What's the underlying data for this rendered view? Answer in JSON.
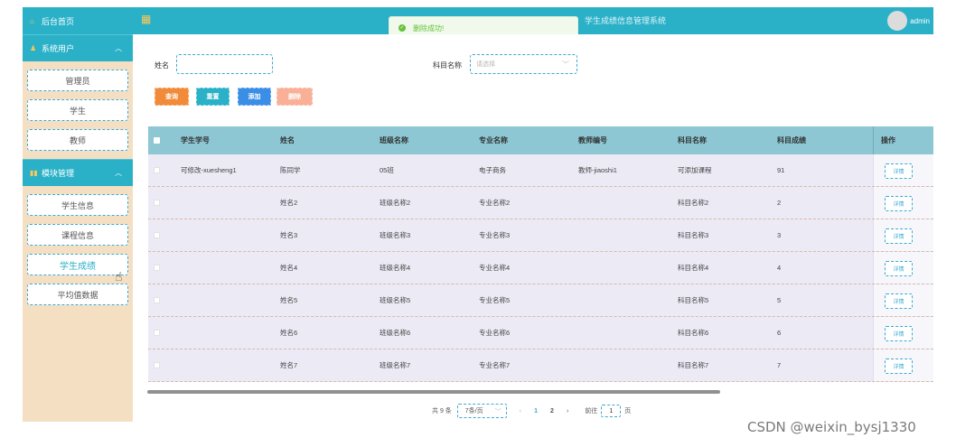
{
  "sidebar": {
    "home_label": "后台首页",
    "groups": [
      {
        "label": "系统用户",
        "items": [
          "管理员",
          "学生",
          "教师"
        ]
      },
      {
        "label": "模块管理",
        "items": [
          "学生信息",
          "课程信息",
          "学生成绩",
          "平均值数据"
        ]
      }
    ],
    "active_item": "学生成绩"
  },
  "topbar": {
    "title": "学生成绩信息管理系统",
    "user": "admin"
  },
  "toast": {
    "message": "删除成功!"
  },
  "search": {
    "name_label": "姓名",
    "name_value": "",
    "subject_label": "科目名称",
    "subject_placeholder": "请选择"
  },
  "buttons": {
    "search": "查询",
    "reset": "重置",
    "add": "添加",
    "delete": "删除"
  },
  "table": {
    "headers": [
      "学生学号",
      "姓名",
      "班级名称",
      "专业名称",
      "教师编号",
      "科目名称",
      "科目成绩",
      "操作"
    ],
    "rows": [
      {
        "id": "可修改-xuesheng1",
        "name": "陈同学",
        "class": "05班",
        "major": "电子商务",
        "teacher": "教师-jiaoshi1",
        "subject": "可添加课程",
        "score": "91",
        "op": "详情"
      },
      {
        "id": "",
        "name": "姓名2",
        "class": "班级名称2",
        "major": "专业名称2",
        "teacher": "",
        "subject": "科目名称2",
        "score": "2",
        "op": "详情"
      },
      {
        "id": "",
        "name": "姓名3",
        "class": "班级名称3",
        "major": "专业名称3",
        "teacher": "",
        "subject": "科目名称3",
        "score": "3",
        "op": "详情"
      },
      {
        "id": "",
        "name": "姓名4",
        "class": "班级名称4",
        "major": "专业名称4",
        "teacher": "",
        "subject": "科目名称4",
        "score": "4",
        "op": "详情"
      },
      {
        "id": "",
        "name": "姓名5",
        "class": "班级名称5",
        "major": "专业名称5",
        "teacher": "",
        "subject": "科目名称5",
        "score": "5",
        "op": "详情"
      },
      {
        "id": "",
        "name": "姓名6",
        "class": "班级名称6",
        "major": "专业名称6",
        "teacher": "",
        "subject": "科目名称6",
        "score": "6",
        "op": "详情"
      },
      {
        "id": "",
        "name": "姓名7",
        "class": "班级名称7",
        "major": "专业名称7",
        "teacher": "",
        "subject": "科目名称7",
        "score": "7",
        "op": "详情"
      }
    ]
  },
  "pagination": {
    "total": "共 9 条",
    "page_size": "7条/页",
    "prev": "‹",
    "pages": [
      "1",
      "2"
    ],
    "current_page": "1",
    "next": "›",
    "goto_prefix": "前往",
    "goto_value": "1",
    "goto_suffix": "页"
  },
  "watermark": "CSDN @weixin_bysj1330",
  "colors": {
    "primary": "#2ab1c8",
    "sidebar_bg": "#f5dfc3",
    "header_row": "#8cc7d3",
    "row_bg": "#ebeaf5",
    "btn_search": "#f28b39",
    "btn_reset": "#2ab1c8",
    "btn_add": "#3a8ee6",
    "btn_delete": "#f9b096"
  }
}
